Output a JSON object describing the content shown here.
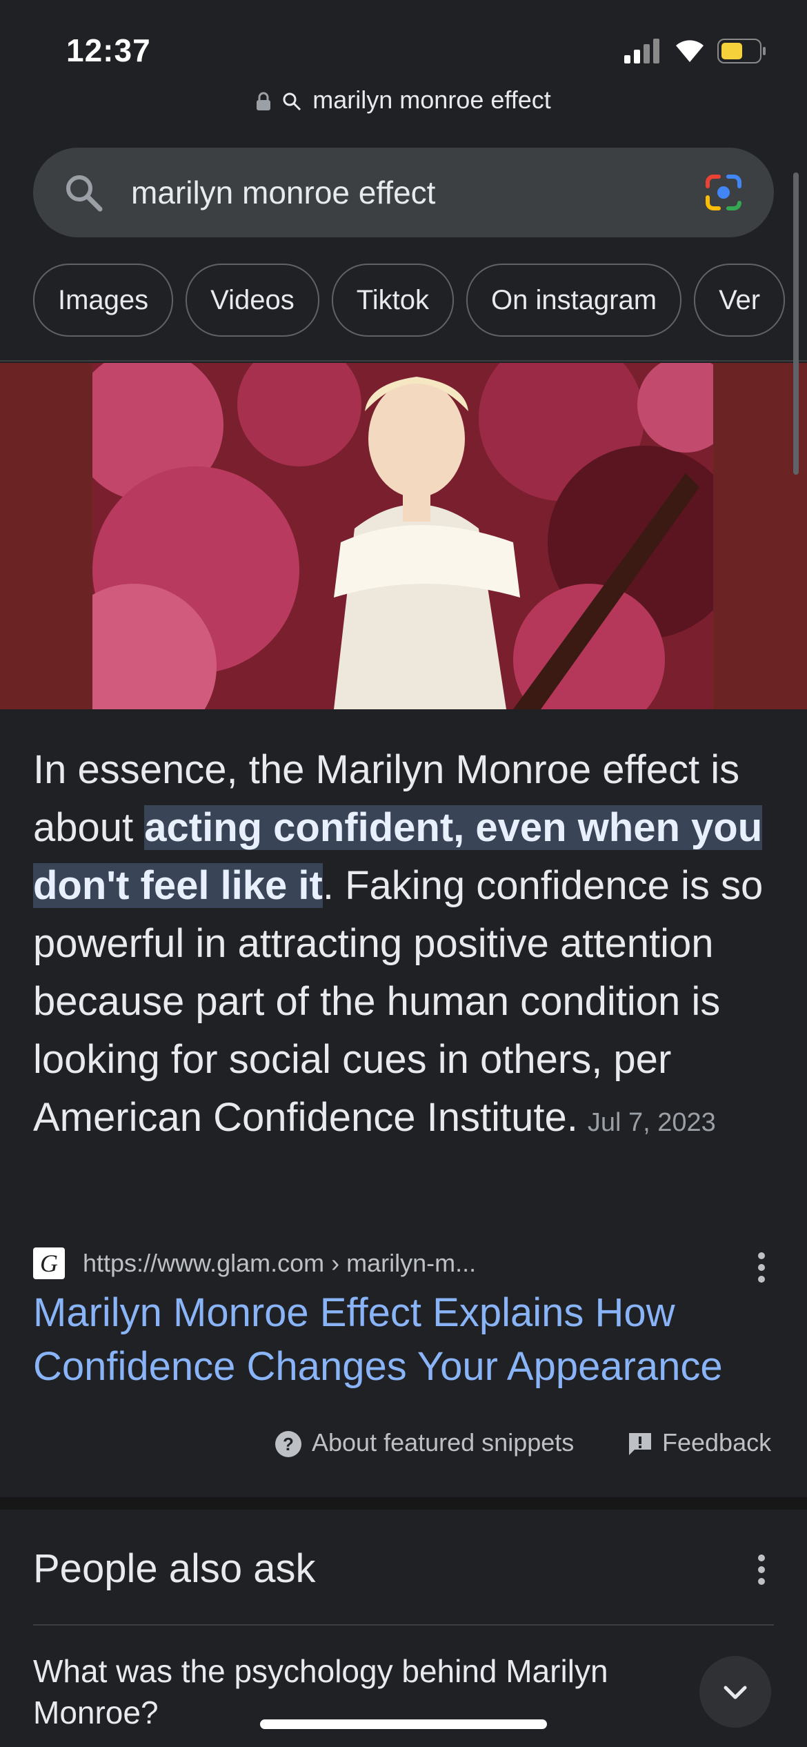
{
  "status_bar": {
    "time": "12:37"
  },
  "url_bar": {
    "text": "marilyn monroe effect"
  },
  "search": {
    "query": "marilyn monroe effect"
  },
  "chips": [
    "Images",
    "Videos",
    "Tiktok",
    "On instagram",
    "Ver"
  ],
  "snippet": {
    "text_before": "In essence, the Marilyn Monroe effect is about ",
    "highlight": "acting confident, even when you don't feel like it",
    "text_after": ". Faking confidence is so powerful in attracting positive attention because part of the human condition is looking for social cues in others, per American Confidence Institute.",
    "date": "Jul 7, 2023"
  },
  "source": {
    "favicon_letter": "G",
    "url": "https://www.glam.com › marilyn-m...",
    "title": "Marilyn Monroe Effect Explains How Confidence Changes Your Appearance"
  },
  "footer_links": {
    "about": "About featured snippets",
    "feedback": "Feedback"
  },
  "people_also_ask": {
    "title": "People also ask",
    "questions": [
      "What was the psychology behind Marilyn Monroe?"
    ]
  },
  "colors": {
    "background": "#202124",
    "link": "#8ab4f8",
    "highlight": "#394457",
    "image_band": "#6b2323"
  },
  "icons": [
    "lock-icon",
    "search-icon",
    "lens-icon",
    "more-vert-icon",
    "help-icon",
    "feedback-icon",
    "chevron-down-icon"
  ]
}
